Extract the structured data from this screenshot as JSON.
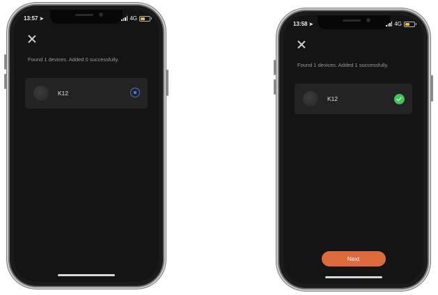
{
  "screen_left": {
    "status": {
      "time": "13:57",
      "network": "4G"
    },
    "result_text": "Found 1 devices. Added 0 successfully.",
    "device": {
      "name": "K12",
      "state": "adding"
    }
  },
  "screen_right": {
    "status": {
      "time": "13:58",
      "network": "4G"
    },
    "result_text": "Found 1 devices. Added 1 successfully.",
    "device": {
      "name": "K12",
      "state": "added"
    },
    "next_label": "Next"
  },
  "colors": {
    "accent_button": "#de6b3e",
    "success_check": "#43c45a",
    "pending_indicator": "#4a6fd6"
  },
  "icons": [
    "location-arrow-icon",
    "signal-icon",
    "battery-icon",
    "close-icon",
    "device-avatar-icon",
    "pending-icon",
    "check-icon"
  ]
}
